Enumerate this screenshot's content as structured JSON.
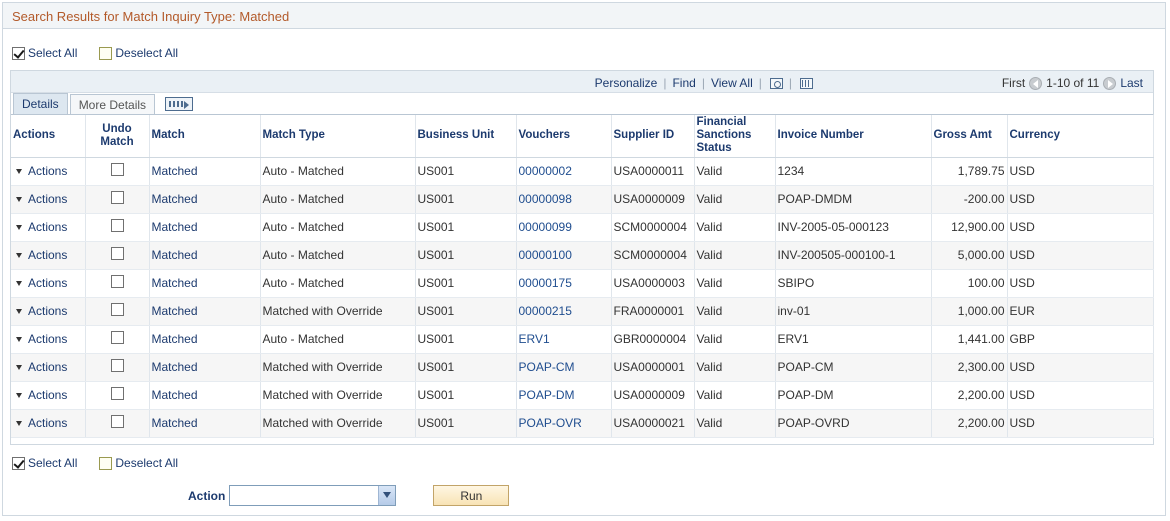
{
  "title": "Search Results for Match Inquiry Type: Matched",
  "select_all": "Select All",
  "deselect_all": "Deselect All",
  "toolbar": {
    "personalize": "Personalize",
    "find": "Find",
    "view_all": "View All",
    "first": "First",
    "range": "1-10 of 11",
    "last": "Last"
  },
  "tabs": [
    "Details",
    "More Details"
  ],
  "columns": [
    "Actions",
    "Undo Match",
    "Match",
    "Match Type",
    "Business Unit",
    "Vouchers",
    "Supplier ID",
    "Financial Sanctions Status",
    "Invoice Number",
    "Gross Amt",
    "Currency"
  ],
  "rows": [
    {
      "actions": "Actions",
      "match": "Matched",
      "match_type": "Auto - Matched",
      "bu": "US001",
      "voucher": "00000002",
      "supplier": "USA0000011",
      "status": "Valid",
      "invoice": "1234",
      "gross": "1,789.75",
      "currency": "USD"
    },
    {
      "actions": "Actions",
      "match": "Matched",
      "match_type": "Auto - Matched",
      "bu": "US001",
      "voucher": "00000098",
      "supplier": "USA0000009",
      "status": "Valid",
      "invoice": "POAP-DMDM",
      "gross": "-200.00",
      "currency": "USD"
    },
    {
      "actions": "Actions",
      "match": "Matched",
      "match_type": "Auto - Matched",
      "bu": "US001",
      "voucher": "00000099",
      "supplier": "SCM0000004",
      "status": "Valid",
      "invoice": "INV-2005-05-000123",
      "gross": "12,900.00",
      "currency": "USD"
    },
    {
      "actions": "Actions",
      "match": "Matched",
      "match_type": "Auto - Matched",
      "bu": "US001",
      "voucher": "00000100",
      "supplier": "SCM0000004",
      "status": "Valid",
      "invoice": "INV-200505-000100-1",
      "gross": "5,000.00",
      "currency": "USD"
    },
    {
      "actions": "Actions",
      "match": "Matched",
      "match_type": "Auto - Matched",
      "bu": "US001",
      "voucher": "00000175",
      "supplier": "USA0000003",
      "status": "Valid",
      "invoice": "SBIPO",
      "gross": "100.00",
      "currency": "USD"
    },
    {
      "actions": "Actions",
      "match": "Matched",
      "match_type": "Matched with Override",
      "bu": "US001",
      "voucher": "00000215",
      "supplier": "FRA0000001",
      "status": "Valid",
      "invoice": "inv-01",
      "gross": "1,000.00",
      "currency": "EUR"
    },
    {
      "actions": "Actions",
      "match": "Matched",
      "match_type": "Auto - Matched",
      "bu": "US001",
      "voucher": "ERV1",
      "supplier": "GBR0000004",
      "status": "Valid",
      "invoice": "ERV1",
      "gross": "1,441.00",
      "currency": "GBP"
    },
    {
      "actions": "Actions",
      "match": "Matched",
      "match_type": "Matched with Override",
      "bu": "US001",
      "voucher": "POAP-CM",
      "supplier": "USA0000001",
      "status": "Valid",
      "invoice": "POAP-CM",
      "gross": "2,300.00",
      "currency": "USD"
    },
    {
      "actions": "Actions",
      "match": "Matched",
      "match_type": "Matched with Override",
      "bu": "US001",
      "voucher": "POAP-DM",
      "supplier": "USA0000009",
      "status": "Valid",
      "invoice": "POAP-DM",
      "gross": "2,200.00",
      "currency": "USD"
    },
    {
      "actions": "Actions",
      "match": "Matched",
      "match_type": "Matched with Override",
      "bu": "US001",
      "voucher": "POAP-OVR",
      "supplier": "USA0000021",
      "status": "Valid",
      "invoice": "POAP-OVRD",
      "gross": "2,200.00",
      "currency": "USD"
    }
  ],
  "action_label": "Action",
  "action_value": "",
  "run_label": "Run",
  "colors": {
    "title": "#b35a2a",
    "link": "#1c3a6e",
    "header_bg": "#eaf0f5"
  }
}
